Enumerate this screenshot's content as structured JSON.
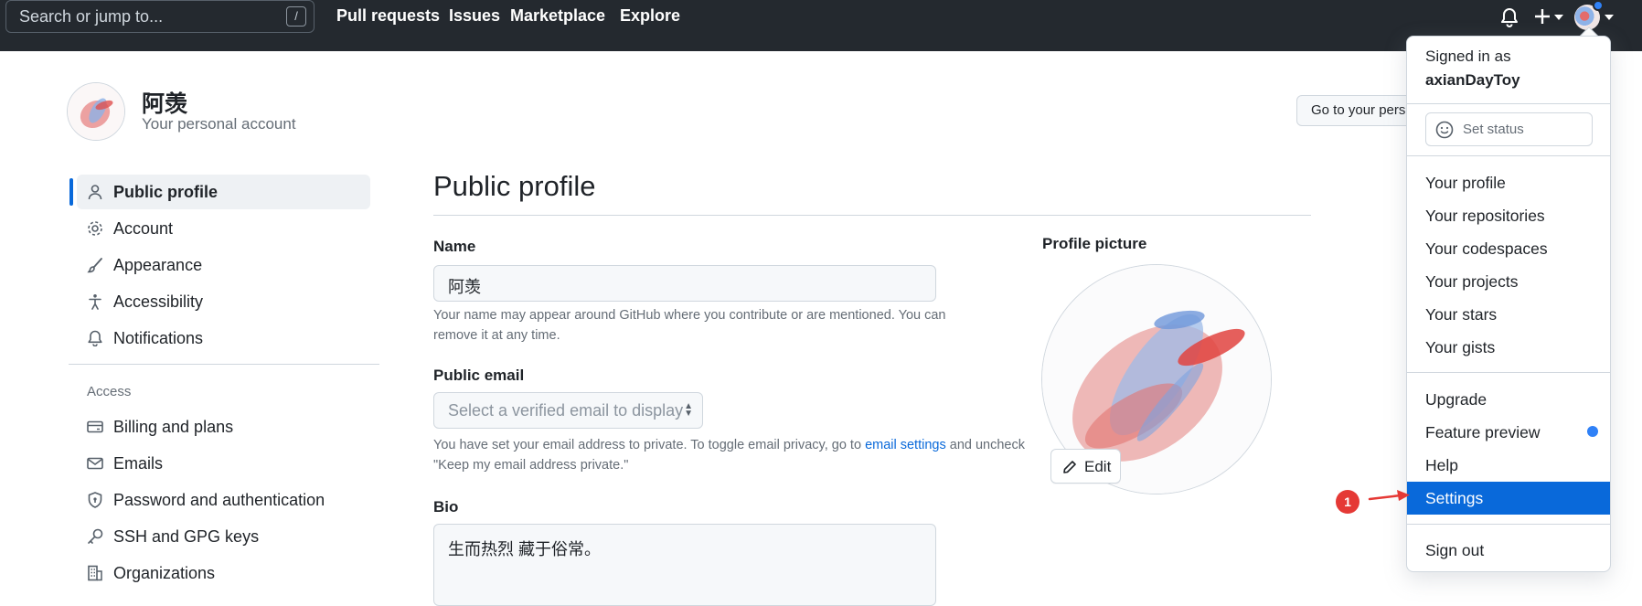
{
  "header": {
    "search_placeholder": "Search or jump to...",
    "search_key": "/",
    "nav": [
      "Pull requests",
      "Issues",
      "Marketplace",
      "Explore"
    ],
    "icons": [
      "bell-icon",
      "plus-icon",
      "avatar"
    ]
  },
  "account": {
    "name": "阿羡",
    "subtitle": "Your personal account",
    "goto_button": "Go to your personal profile"
  },
  "sidebar": {
    "items": [
      {
        "label": "Public profile",
        "icon": "person-icon",
        "active": true
      },
      {
        "label": "Account",
        "icon": "gear-icon"
      },
      {
        "label": "Appearance",
        "icon": "paintbrush-icon"
      },
      {
        "label": "Accessibility",
        "icon": "accessibility-icon"
      },
      {
        "label": "Notifications",
        "icon": "bell-icon"
      }
    ],
    "access_heading": "Access",
    "access_items": [
      {
        "label": "Billing and plans",
        "icon": "credit-card-icon"
      },
      {
        "label": "Emails",
        "icon": "mail-icon"
      },
      {
        "label": "Password and authentication",
        "icon": "shield-icon"
      },
      {
        "label": "SSH and GPG keys",
        "icon": "key-icon"
      },
      {
        "label": "Organizations",
        "icon": "organization-icon"
      }
    ]
  },
  "main": {
    "title": "Public profile",
    "name_label": "Name",
    "name_value": "阿羡",
    "name_note": "Your name may appear around GitHub where you contribute or are mentioned. You can remove it at any time.",
    "email_label": "Public email",
    "email_placeholder": "Select a verified email to display",
    "email_note_before": "You have set your email address to private. To toggle email privacy, go to",
    "email_note_link": "email settings",
    "email_note_after": "and uncheck \"Keep my email address private.\"",
    "bio_label": "Bio",
    "bio_value": "生而热烈 藏于俗常。",
    "picture_label": "Profile picture",
    "edit_button": "Edit"
  },
  "dropdown": {
    "signed_in_as": "Signed in as",
    "username": "axianDayToy",
    "set_status": "Set status",
    "group1": [
      "Your profile",
      "Your repositories",
      "Your codespaces",
      "Your projects",
      "Your stars",
      "Your gists"
    ],
    "group2": [
      "Upgrade",
      "Feature preview",
      "Help",
      "Settings"
    ],
    "highlighted": "Settings",
    "sign_out": "Sign out"
  },
  "annotation": {
    "badge": "1",
    "color": "#e53935"
  },
  "colors": {
    "header_bg": "#24292f",
    "accent": "#0969da",
    "border": "#d0d7de"
  }
}
